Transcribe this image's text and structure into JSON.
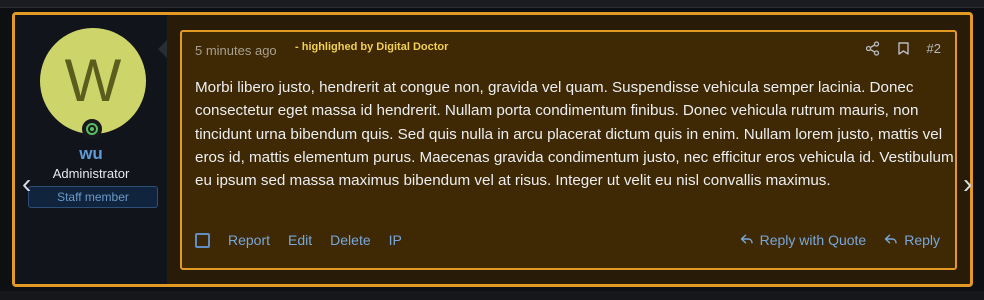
{
  "post": {
    "time": "5 minutes ago",
    "highlight_note": "- highlighed by Digital Doctor",
    "number": "#2",
    "message": "Morbi libero justo, hendrerit at congue non, gravida vel quam. Suspendisse vehicula semper lacinia. Donec consectetur eget massa id hendrerit. Nullam porta condimentum finibus. Donec vehicula rutrum mauris, non tincidunt urna bibendum quis. Sed quis nulla in arcu placerat dictum quis in enim. Nullam lorem justo, mattis vel eros id, mattis elementum purus. Maecenas gravida condimentum justo, nec efficitur eros vehicula id. Vestibulum eu ipsum sed massa maximus bibendum vel at risus. Integer ut velit eu nisl convallis maximus."
  },
  "user": {
    "avatar_letter": "W",
    "name": "wu",
    "title": "Administrator",
    "badge": "Staff member"
  },
  "actions": {
    "report": "Report",
    "edit": "Edit",
    "delete": "Delete",
    "ip": "IP",
    "reply_quote": "Reply with Quote",
    "reply": "Reply"
  },
  "icons": {
    "share": "share-icon",
    "bookmark": "bookmark-icon",
    "prev": "chevron-left-icon",
    "next": "chevron-right-icon",
    "online": "online-status-icon",
    "select": "checkbox-icon"
  },
  "colors": {
    "highlight": "#e39a25",
    "content_bg": "#3e2904",
    "link": "#78a7dc",
    "username": "#5f9bd6",
    "avatar": "#cdd56a"
  }
}
